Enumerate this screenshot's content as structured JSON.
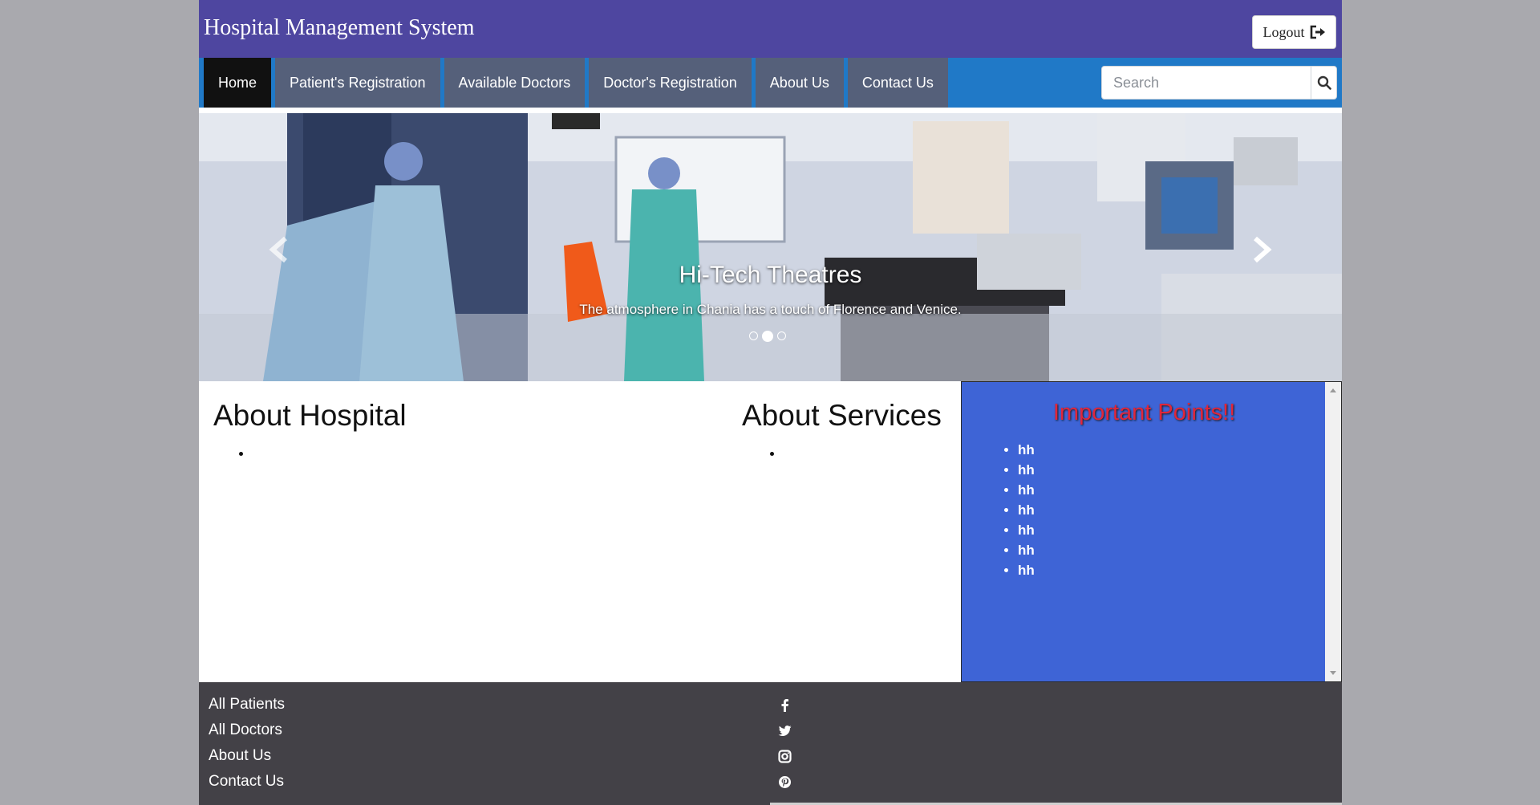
{
  "header": {
    "title": "Hospital Management System",
    "logout_label": "Logout"
  },
  "nav": {
    "items": [
      {
        "label": "Home"
      },
      {
        "label": "Patient's Registration"
      },
      {
        "label": "Available Doctors"
      },
      {
        "label": "Doctor's Registration"
      },
      {
        "label": "About Us"
      },
      {
        "label": "Contact Us"
      }
    ],
    "active": "Home",
    "search_placeholder": "Search"
  },
  "carousel": {
    "caption_title": "Hi-Tech Theatres",
    "caption_text": "The atmosphere in Chania has a touch of Florence and Venice.",
    "slide_count": 3,
    "active_slide": 2
  },
  "main": {
    "about_hospital_title": "About Hospital",
    "about_services_title": "About Services",
    "important_title": "Important Points!!",
    "important_points": [
      "hh",
      "hh",
      "hh",
      "hh",
      "hh",
      "hh",
      "hh"
    ]
  },
  "footer": {
    "links": [
      "All Patients",
      "All Doctors",
      "About Us",
      "Contact Us"
    ],
    "social_icons": [
      "facebook-icon",
      "twitter-icon",
      "instagram-icon",
      "pinterest-icon"
    ]
  },
  "colors": {
    "header_bg": "#4e46a0",
    "nav_bg": "#2079c7",
    "nav_item_bg": "#55607a",
    "nav_active_bg": "#111111",
    "points_bg": "#3e64d6",
    "points_title": "#e0263b",
    "footer_bg": "#434147"
  }
}
